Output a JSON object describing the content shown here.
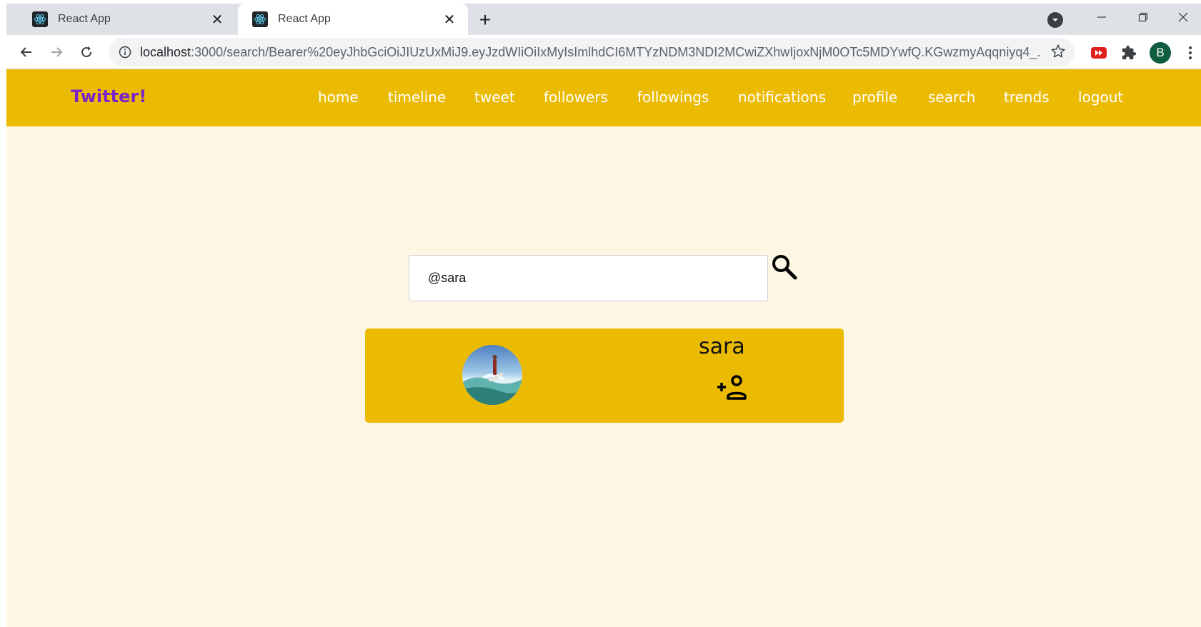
{
  "browser": {
    "tabs": [
      {
        "title": "React App",
        "active": false
      },
      {
        "title": "React App",
        "active": true
      }
    ],
    "new_tab_label": "+",
    "url_host": "localhost",
    "url_rest": ":3000/search/Bearer%20eyJhbGciOiJIUzUxMiJ9.eyJzdWIiOiIxMyIsImlhdCI6MTYzNDM3NDI2MCwiZXhwIjoxNjM0OTc5MDYwfQ.KGwzmyAqqniyq4_...",
    "profile_initial": "B"
  },
  "app": {
    "brand": "Twitter!",
    "nav": [
      "home",
      "timeline",
      "tweet",
      "followers",
      "followings",
      "notifications",
      "profile",
      "search",
      "trends",
      "logout"
    ],
    "search": {
      "value": "@sara"
    },
    "result": {
      "username": "sara"
    },
    "colors": {
      "nav_bg": "#ebbb03",
      "page_bg": "#fdf6e4",
      "brand": "#7b23c9",
      "card_bg": "#ebbb03"
    }
  }
}
